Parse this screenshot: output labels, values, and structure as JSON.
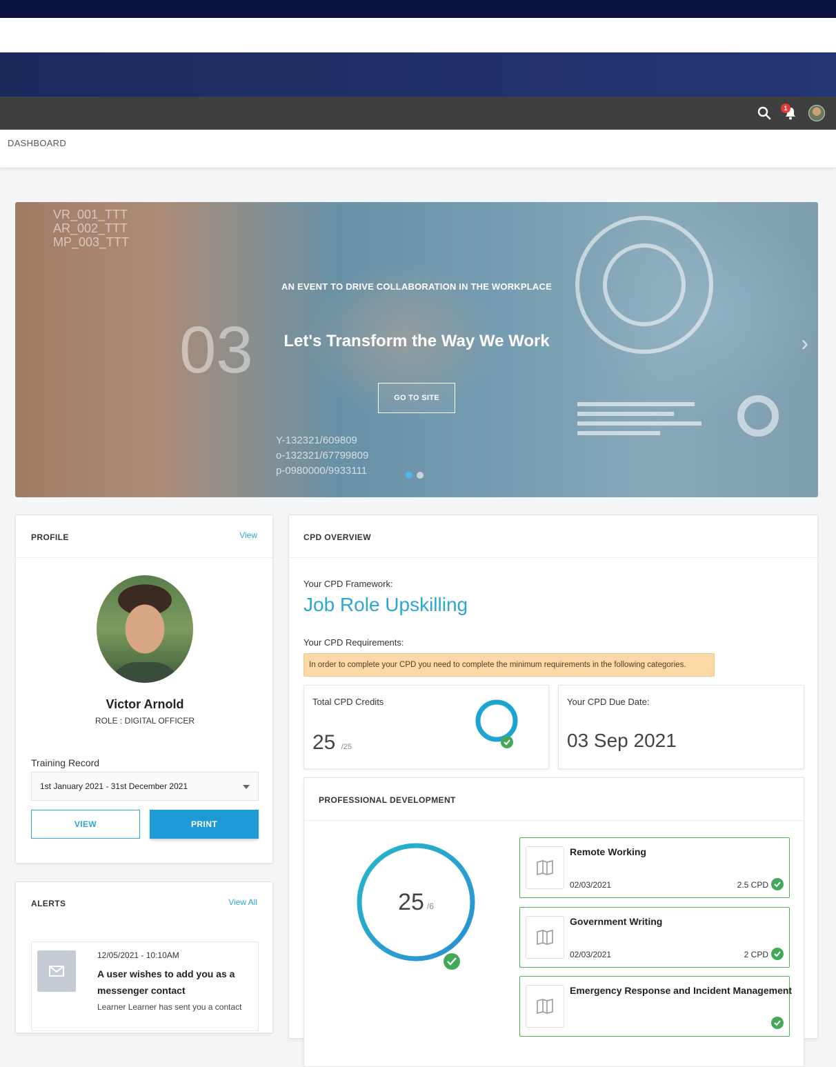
{
  "breadcrumb": "DASHBOARD",
  "notifications": {
    "count": "1"
  },
  "hero": {
    "eyebrow": "AN EVENT TO DRIVE COLLABORATION IN THE WORKPLACE",
    "headline": "Let's Transform the Way We Work",
    "cta": "GO TO SITE",
    "slide_number": "03",
    "hud_lines": [
      "VR_001_TTT",
      "AR_002_TTT",
      "MP_003_TTT"
    ],
    "codes": [
      "Y-132321/609809",
      "o-132321/67799809",
      "p-0980000/9933111"
    ]
  },
  "profile": {
    "title": "PROFILE",
    "view_link": "View",
    "name": "Victor Arnold",
    "role": "ROLE : DIGITAL OFFICER",
    "training_label": "Training Record",
    "training_period": "1st January 2021 - 31st December 2021",
    "view_button": "VIEW",
    "print_button": "PRINT"
  },
  "alerts": {
    "title": "ALERTS",
    "view_all": "View All",
    "items": [
      {
        "time": "12/05/2021 - 10:10AM",
        "title": "A user wishes to add you as a messenger contact",
        "body": "Learner Learner has sent you a contact"
      }
    ]
  },
  "cpd": {
    "title": "CPD OVERVIEW",
    "framework_label": "Your CPD Framework:",
    "framework_value": "Job Role Upskilling",
    "requirements_label": "Your CPD Requirements:",
    "requirements_note": "In order to complete your CPD you need to complete the minimum requirements in the following categories.",
    "total_label": "Total CPD Credits",
    "total_value": "25",
    "total_max": "/25",
    "due_label": "Your CPD Due Date:",
    "due_value": "03 Sep 2021"
  },
  "professional_development": {
    "title": "PROFESSIONAL DEVELOPMENT",
    "value": "25",
    "max": "/6",
    "courses": [
      {
        "title": "Remote Working",
        "date": "02/03/2021",
        "credit": "2.5 CPD"
      },
      {
        "title": "Government Writing",
        "date": "02/03/2021",
        "credit": "2 CPD"
      },
      {
        "title": "Emergency Response and Incident Management",
        "date": "",
        "credit": ""
      }
    ]
  },
  "colors": {
    "accent": "#2aa7d4",
    "success": "#43a95a",
    "appbar": "#3f3f3f",
    "banner": "#0a1240"
  }
}
